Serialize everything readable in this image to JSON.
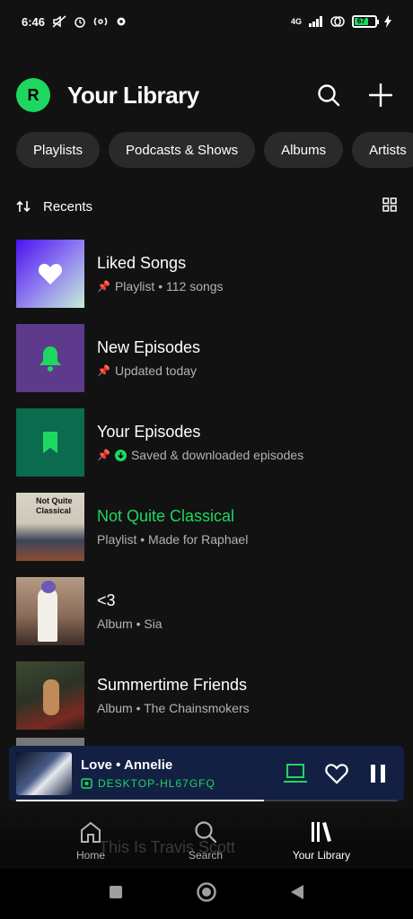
{
  "status": {
    "time": "6:46",
    "network": "4G",
    "battery": "67"
  },
  "header": {
    "avatar_letter": "R",
    "title": "Your Library"
  },
  "filters": [
    "Playlists",
    "Podcasts & Shows",
    "Albums",
    "Artists"
  ],
  "sort": {
    "label": "Recents"
  },
  "items": [
    {
      "title": "Liked Songs",
      "sub": "Playlist • 112 songs",
      "pinned": true
    },
    {
      "title": "New Episodes",
      "sub": "Updated today",
      "pinned": true
    },
    {
      "title": "Your Episodes",
      "sub": "Saved & downloaded episodes",
      "pinned": true,
      "downloaded": true
    },
    {
      "title": "Not Quite Classical",
      "sub": "Playlist • Made for Raphael",
      "art_text": "Not Quite Classical",
      "playing": true
    },
    {
      "title": "<3",
      "sub": "Album • Sia"
    },
    {
      "title": "Summertime Friends",
      "sub": "Album • The Chainsmokers"
    }
  ],
  "partially_hidden_item": "This Is Travis Scott",
  "now_playing": {
    "title": "Love • Annelie",
    "device": "DESKTOP-HL67GFQ",
    "progress": 0.65
  },
  "nav": {
    "home": "Home",
    "search": "Search",
    "library": "Your Library"
  },
  "colors": {
    "accent": "#1ed760",
    "background": "#121212",
    "player_bg": "#132044"
  }
}
